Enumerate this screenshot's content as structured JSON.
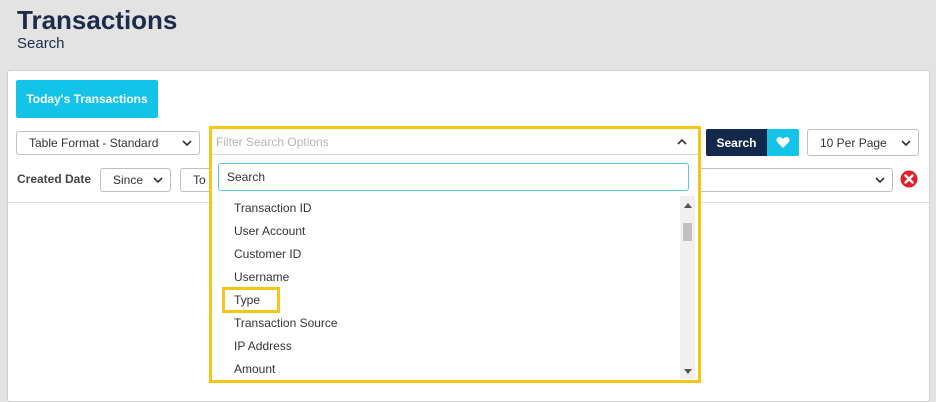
{
  "header": {
    "title": "Transactions",
    "subtitle": "Search"
  },
  "toolbar": {
    "today_button": "Today's Transactions",
    "table_format": "Table Format - Standard",
    "filter_placeholder": "Filter Search Options",
    "search_button": "Search",
    "per_page": "10 Per Page"
  },
  "filters": {
    "created_date_label": "Created Date",
    "since_value": "Since",
    "to_value": "To"
  },
  "dropdown": {
    "search_placeholder": "Search",
    "options": [
      "Transaction ID",
      "User Account",
      "Customer ID",
      "Username",
      "Type",
      "Transaction Source",
      "IP Address",
      "Amount"
    ]
  },
  "colors": {
    "accent": "#14c3e8",
    "navy": "#13294b",
    "highlight": "#f5c518",
    "danger": "#e0202b"
  },
  "icons": [
    "chevron-down-icon",
    "chevron-up-icon",
    "heart-icon",
    "clear-icon"
  ]
}
